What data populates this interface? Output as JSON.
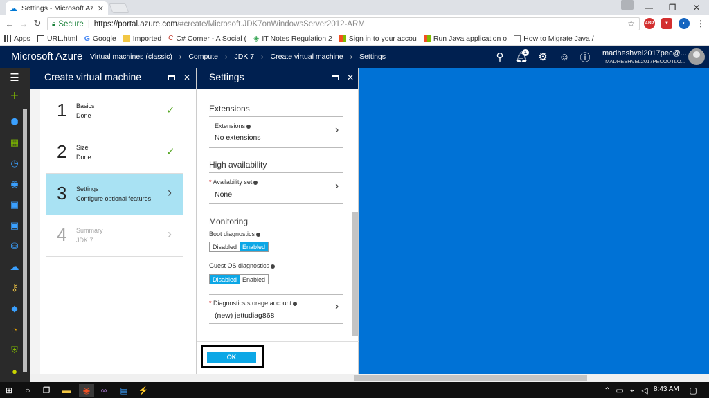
{
  "browser": {
    "tab_title": "Settings - Microsoft Azur",
    "secure_label": "Secure",
    "url_host": "https://portal.azure.com",
    "url_path": "/#create/Microsoft.JDK7onWindowsServer2012-ARM"
  },
  "bookmarks": [
    {
      "label": "Apps",
      "icon_color": "#444444"
    },
    {
      "label": "URL.html",
      "icon_color": "#444444"
    },
    {
      "label": "Google",
      "icon_color": "#4285f4"
    },
    {
      "label": "Imported",
      "icon_color": "#f2c744"
    },
    {
      "label": "C# Corner - A Social (",
      "icon_color": "#c0392b"
    },
    {
      "label": "IT Notes Regulation 2",
      "icon_color": "#3aa757"
    },
    {
      "label": "Sign in to your accou",
      "icon_color": "#f25022"
    },
    {
      "label": "Run Java application o",
      "icon_color": "#f25022"
    },
    {
      "label": "How to Migrate Java /",
      "icon_color": "#777777"
    }
  ],
  "azure": {
    "brand": "Microsoft Azure",
    "breadcrumbs": [
      "Virtual machines (classic)",
      "Compute",
      "JDK 7",
      "Create virtual machine",
      "Settings"
    ],
    "notification_count": "1",
    "user_name": "madheshvel2017pec@...",
    "user_directory": "MADHESHVEL2017PECOUTLO..."
  },
  "create_blade": {
    "title": "Create virtual machine",
    "steps": [
      {
        "num": "1",
        "name": "Basics",
        "status": "Done"
      },
      {
        "num": "2",
        "name": "Size",
        "status": "Done"
      },
      {
        "num": "3",
        "name": "Settings",
        "status": "Configure optional features"
      },
      {
        "num": "4",
        "name": "Summary",
        "status": "JDK 7"
      }
    ]
  },
  "settings_blade": {
    "title": "Settings",
    "extensions_heading": "Extensions",
    "extensions_label": "Extensions",
    "extensions_value": "No extensions",
    "ha_heading": "High availability",
    "availability_label": "Availability set",
    "availability_value": "None",
    "monitoring_heading": "Monitoring",
    "boot_diag_label": "Boot diagnostics",
    "guest_diag_label": "Guest OS diagnostics",
    "toggle_disabled": "Disabled",
    "toggle_enabled": "Enabled",
    "boot_diag_state": "Enabled",
    "guest_diag_state": "Disabled",
    "storage_label": "Diagnostics storage account",
    "storage_value": "(new) jettudiag868",
    "required_mark": "*",
    "ok_label": "OK"
  },
  "taskbar": {
    "clock": "8:43 AM"
  },
  "colors": {
    "azure_navy": "#002050",
    "azure_accent": "#0ca7e6",
    "active_step": "#a9e2f3",
    "canvas_blue": "#0072d6",
    "check_green": "#5aa829"
  }
}
